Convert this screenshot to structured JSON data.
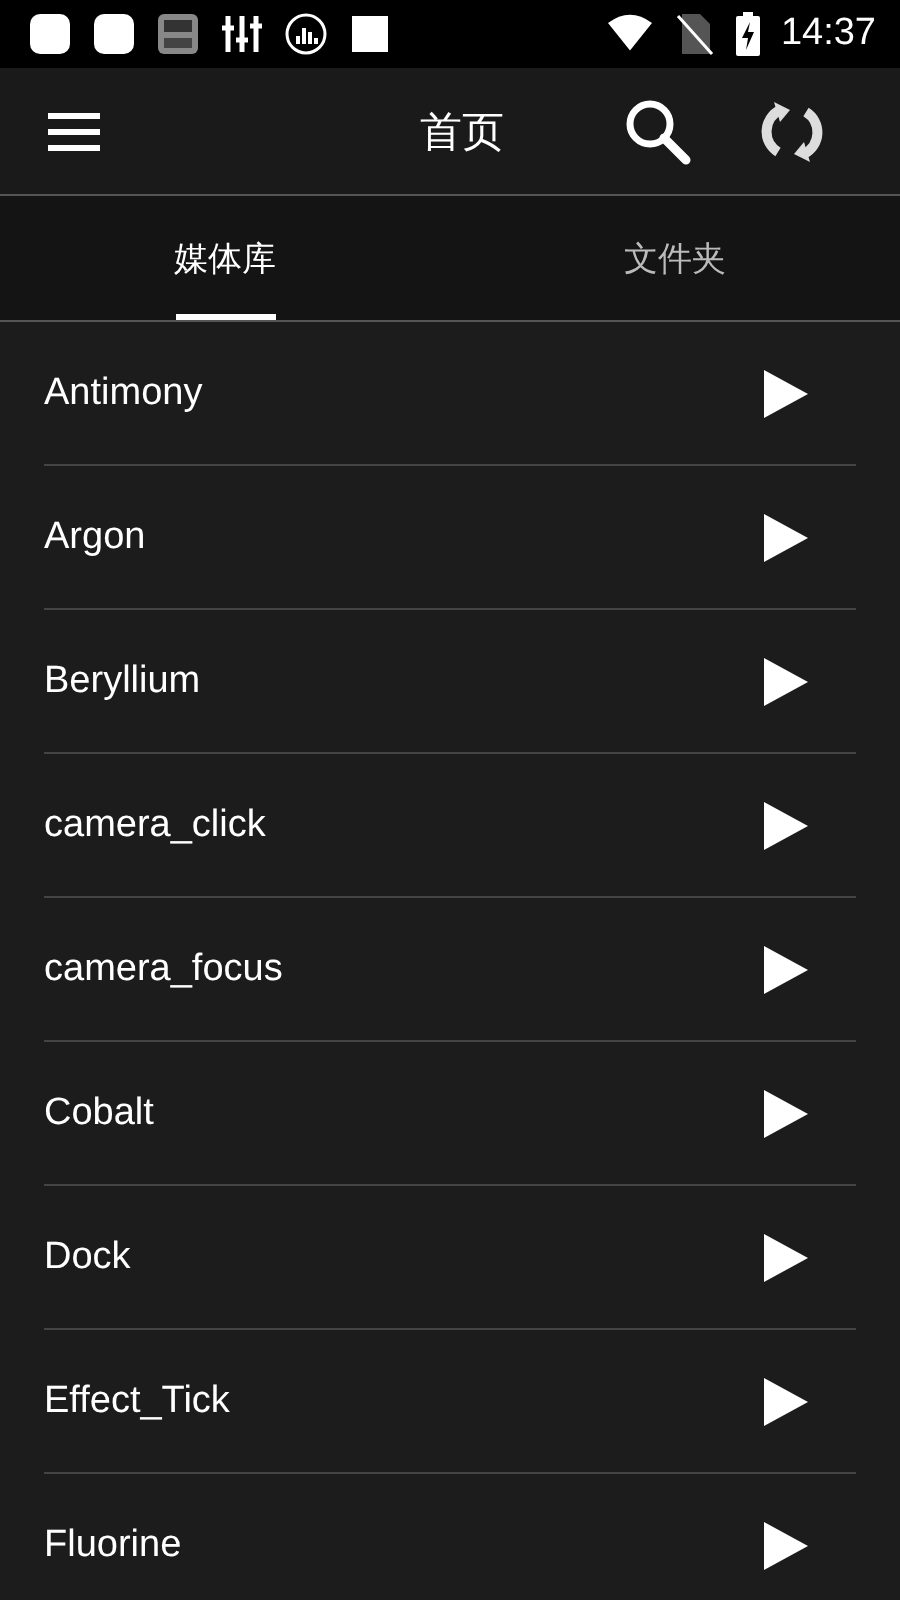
{
  "status_bar": {
    "time": "14:37"
  },
  "app_bar": {
    "title": "首页"
  },
  "tabs": [
    {
      "label": "媒体库",
      "selected": true
    },
    {
      "label": "文件夹",
      "selected": false
    }
  ],
  "items": [
    {
      "name": "Antimony"
    },
    {
      "name": "Argon"
    },
    {
      "name": "Beryllium"
    },
    {
      "name": "camera_click"
    },
    {
      "name": "camera_focus"
    },
    {
      "name": "Cobalt"
    },
    {
      "name": "Dock"
    },
    {
      "name": "Effect_Tick"
    },
    {
      "name": "Fluorine"
    }
  ]
}
